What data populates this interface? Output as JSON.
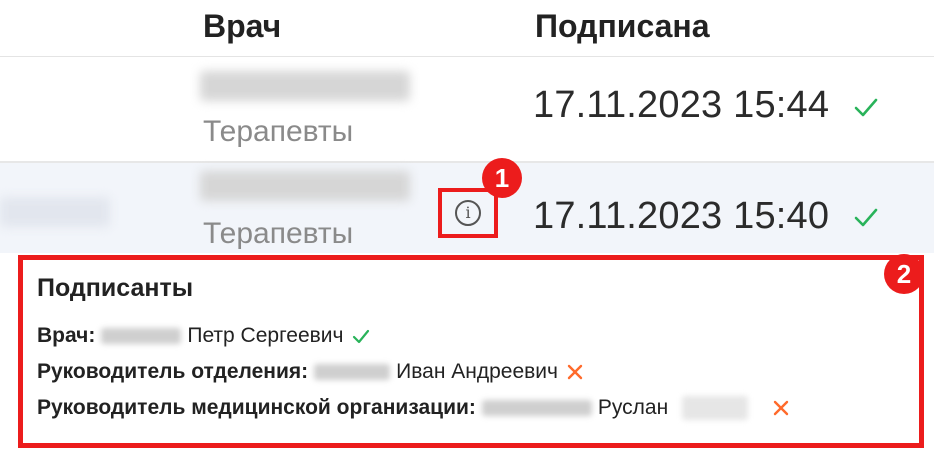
{
  "table": {
    "headers": {
      "doctor": "Врач",
      "signed": "Подписана"
    },
    "rows": [
      {
        "specialty": "Терапевты",
        "signed_at": "17.11.2023 15:44",
        "status_icon": "check-icon"
      },
      {
        "specialty": "Терапевты",
        "signed_at": "17.11.2023 15:40",
        "status_icon": "check-icon"
      }
    ]
  },
  "annotations": {
    "badge1": "1",
    "badge2": "2"
  },
  "popup": {
    "title": "Подписанты",
    "signers": [
      {
        "role": "Врач:",
        "name": "Петр Сергеевич",
        "status": "signed"
      },
      {
        "role": "Руководитель отделения:",
        "name": "Иван Андреевич",
        "status": "not-signed"
      },
      {
        "role": "Руководитель медицинской организации:",
        "name": "Руслан",
        "status": "not-signed"
      }
    ]
  },
  "colors": {
    "check": "#29b35a",
    "cross": "#ff6a2b",
    "highlight": "#ec1c1c",
    "row_selected_bg": "#f2f5fa"
  }
}
